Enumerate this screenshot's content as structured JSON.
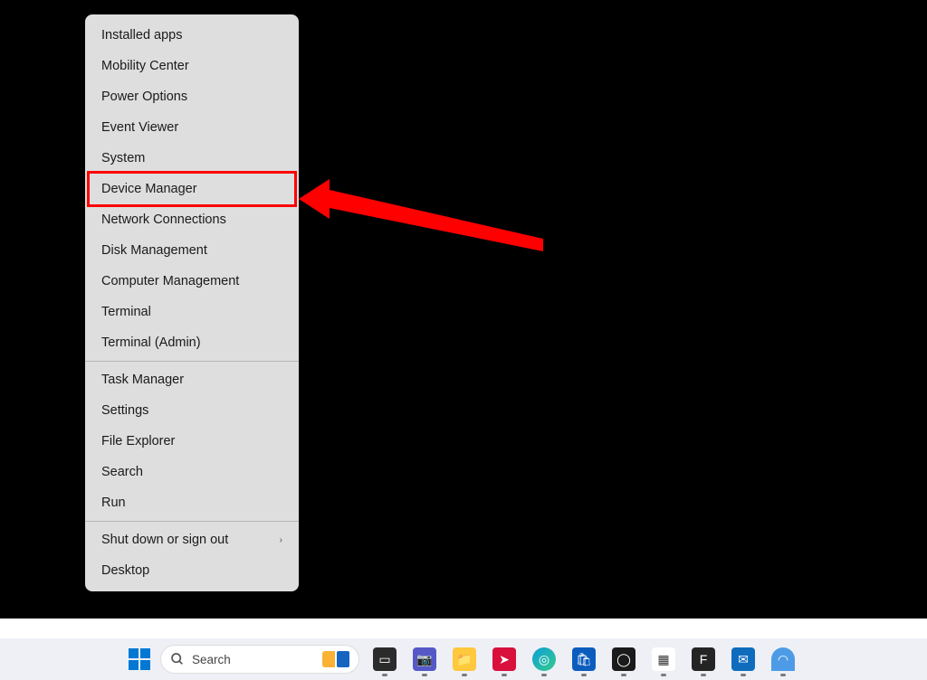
{
  "context_menu": {
    "groups": [
      [
        "Installed apps",
        "Mobility Center",
        "Power Options",
        "Event Viewer",
        "System",
        "Device Manager",
        "Network Connections",
        "Disk Management",
        "Computer Management",
        "Terminal",
        "Terminal (Admin)"
      ],
      [
        "Task Manager",
        "Settings",
        "File Explorer",
        "Search",
        "Run"
      ],
      [
        "Shut down or sign out",
        "Desktop"
      ]
    ],
    "submenu_items": [
      "Shut down or sign out"
    ],
    "highlighted_item": "Device Manager"
  },
  "annotation": {
    "arrow_color": "#ff0000",
    "highlight_color": "#ff0000"
  },
  "taskbar": {
    "search_placeholder": "Search",
    "icons": [
      {
        "name": "task-view",
        "bg": "#2b2b2b",
        "glyph": "▭"
      },
      {
        "name": "teams",
        "bg": "#5558c7",
        "glyph": "📷"
      },
      {
        "name": "file-explorer",
        "bg": "#ffc83d",
        "glyph": "📁"
      },
      {
        "name": "screenrec",
        "bg": "#d8103b",
        "glyph": "➤"
      },
      {
        "name": "edge",
        "bg": "linear-gradient(135deg,#0c9fd6,#36c98e)",
        "glyph": "◎"
      },
      {
        "name": "microsoft-store",
        "bg": "#0b5cbd",
        "glyph": "🛍"
      },
      {
        "name": "obs",
        "bg": "#1a1a1a",
        "glyph": "◯"
      },
      {
        "name": "powertoys",
        "bg": "#ffffff",
        "glyph": "▦"
      },
      {
        "name": "figma",
        "bg": "#242424",
        "glyph": "F"
      },
      {
        "name": "outlook-new",
        "bg": "#0f6cbd",
        "glyph": "✉"
      },
      {
        "name": "nordvpn",
        "bg": "#4d9be6",
        "glyph": "◠"
      }
    ]
  }
}
